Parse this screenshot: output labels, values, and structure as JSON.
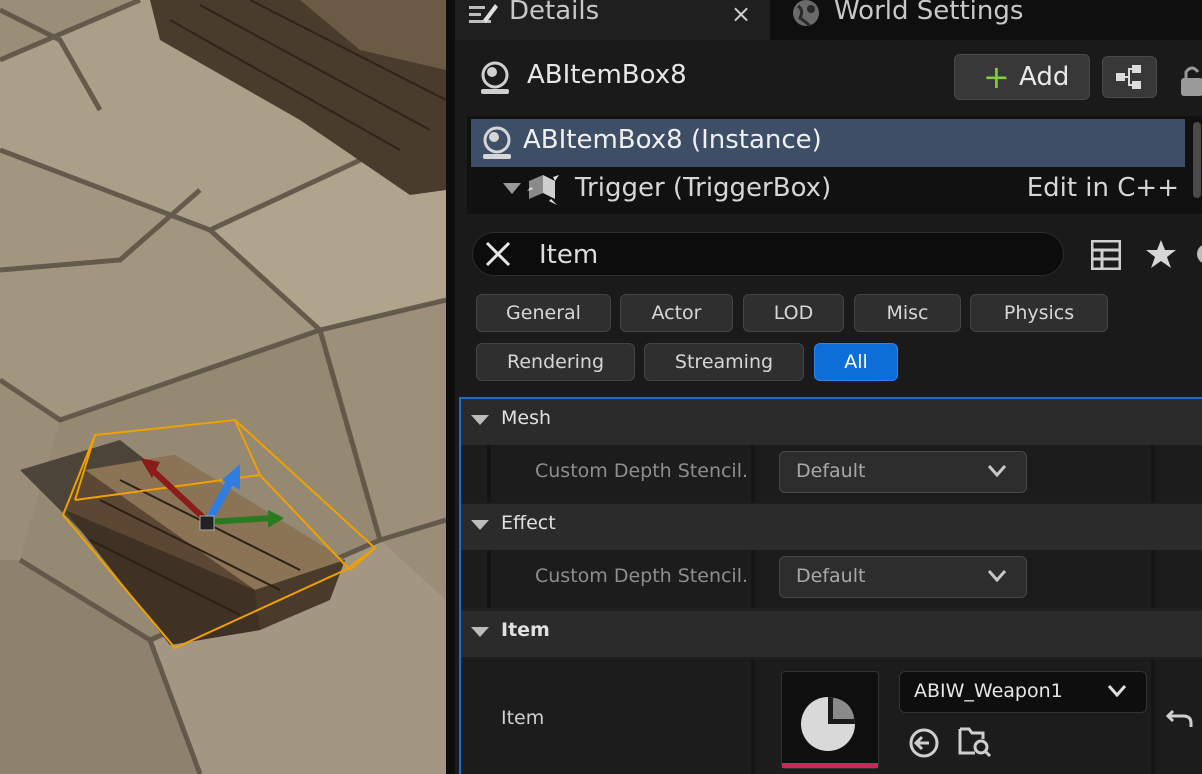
{
  "tabs": {
    "details": {
      "label": "Details",
      "close": "×"
    },
    "world_settings": {
      "label": "World Settings"
    }
  },
  "actor": {
    "name": "ABItemBox8",
    "add_label": "Add",
    "add_plus": "+"
  },
  "component_tree": {
    "root": "ABItemBox8 (Instance)",
    "child": "Trigger (TriggerBox)",
    "edit_link": "Edit in C++"
  },
  "search": {
    "value": "Item"
  },
  "categories": [
    "General",
    "Actor",
    "LOD",
    "Misc",
    "Physics",
    "Rendering",
    "Streaming",
    "All"
  ],
  "active_category": "All",
  "sections": {
    "mesh": {
      "label": "Mesh",
      "prop": "Custom Depth Stencil...",
      "value": "Default"
    },
    "effect": {
      "label": "Effect",
      "prop": "Custom Depth Stencil...",
      "value": "Default"
    },
    "item": {
      "label": "Item",
      "prop": "Item",
      "value": "ABIW_Weapon1"
    }
  },
  "colors": {
    "accent_blue": "#0e6ed8",
    "add_green": "#7fd13b",
    "selection": "#3d4f66",
    "asset_bar": "#c8285a",
    "gizmo_box": "#f0a000"
  },
  "icons": [
    "details-icon",
    "close-icon",
    "world-settings-icon",
    "actor-icon",
    "add-icon",
    "blueprint-icon",
    "lock-icon",
    "trigger-icon",
    "clear-search-icon",
    "grid-view-icon",
    "star-icon",
    "settings-icon",
    "chevron-down-icon",
    "use-selected-icon",
    "browse-icon",
    "reset-icon"
  ]
}
